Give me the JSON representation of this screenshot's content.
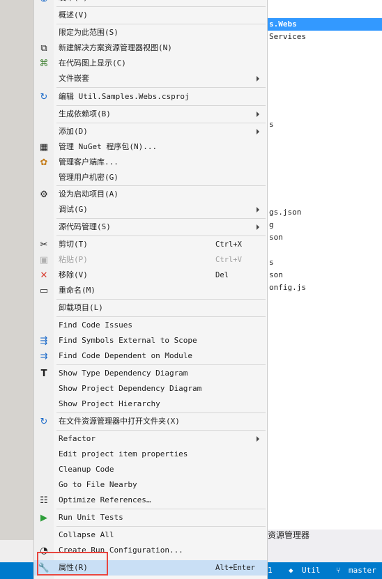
{
  "tree": {
    "selected_item": "s.Webs",
    "items": [
      "Services",
      "s",
      "gs.json",
      "g",
      "son",
      "s",
      "son",
      "onfig.js"
    ]
  },
  "bottom_tab": {
    "label": "资源管理器"
  },
  "statusbar": {
    "left_fragment": "1",
    "project": "Util",
    "branch": "master"
  },
  "menu": {
    "top_partial": "发布(B)...",
    "items": [
      {
        "label": "概述(V)"
      },
      {
        "label": "限定为此范围(S)"
      },
      {
        "label": "新建解决方案资源管理器视图(N)"
      },
      {
        "label": "在代码图上显示(C)"
      },
      {
        "label": "文件嵌套"
      },
      {
        "label": "编辑 Util.Samples.Webs.csproj"
      },
      {
        "label": "生成依赖项(B)"
      },
      {
        "label": "添加(D)"
      },
      {
        "label": "管理 NuGet 程序包(N)..."
      },
      {
        "label": "管理客户端库..."
      },
      {
        "label": "管理用户机密(G)"
      },
      {
        "label": "设为启动项目(A)"
      },
      {
        "label": "调试(G)"
      },
      {
        "label": "源代码管理(S)"
      },
      {
        "label": "剪切(T)",
        "shortcut": "Ctrl+X"
      },
      {
        "label": "粘贴(P)",
        "shortcut": "Ctrl+V"
      },
      {
        "label": "移除(V)",
        "shortcut": "Del"
      },
      {
        "label": "重命名(M)"
      },
      {
        "label": "卸载项目(L)"
      },
      {
        "label": "Find Code Issues"
      },
      {
        "label": "Find Symbols External to Scope"
      },
      {
        "label": "Find Code Dependent on Module"
      },
      {
        "label": "Show Type Dependency Diagram"
      },
      {
        "label": "Show Project Dependency Diagram"
      },
      {
        "label": "Show Project Hierarchy"
      },
      {
        "label": "在文件资源管理器中打开文件夹(X)"
      },
      {
        "label": "Refactor"
      },
      {
        "label": "Edit project item properties"
      },
      {
        "label": "Cleanup Code"
      },
      {
        "label": "Go to File Nearby"
      },
      {
        "label": "Optimize References…"
      },
      {
        "label": "Run Unit Tests"
      },
      {
        "label": "Collapse All"
      },
      {
        "label": "Create Run Configuration..."
      },
      {
        "label": "属性(R)",
        "shortcut": "Alt+Enter"
      }
    ]
  }
}
